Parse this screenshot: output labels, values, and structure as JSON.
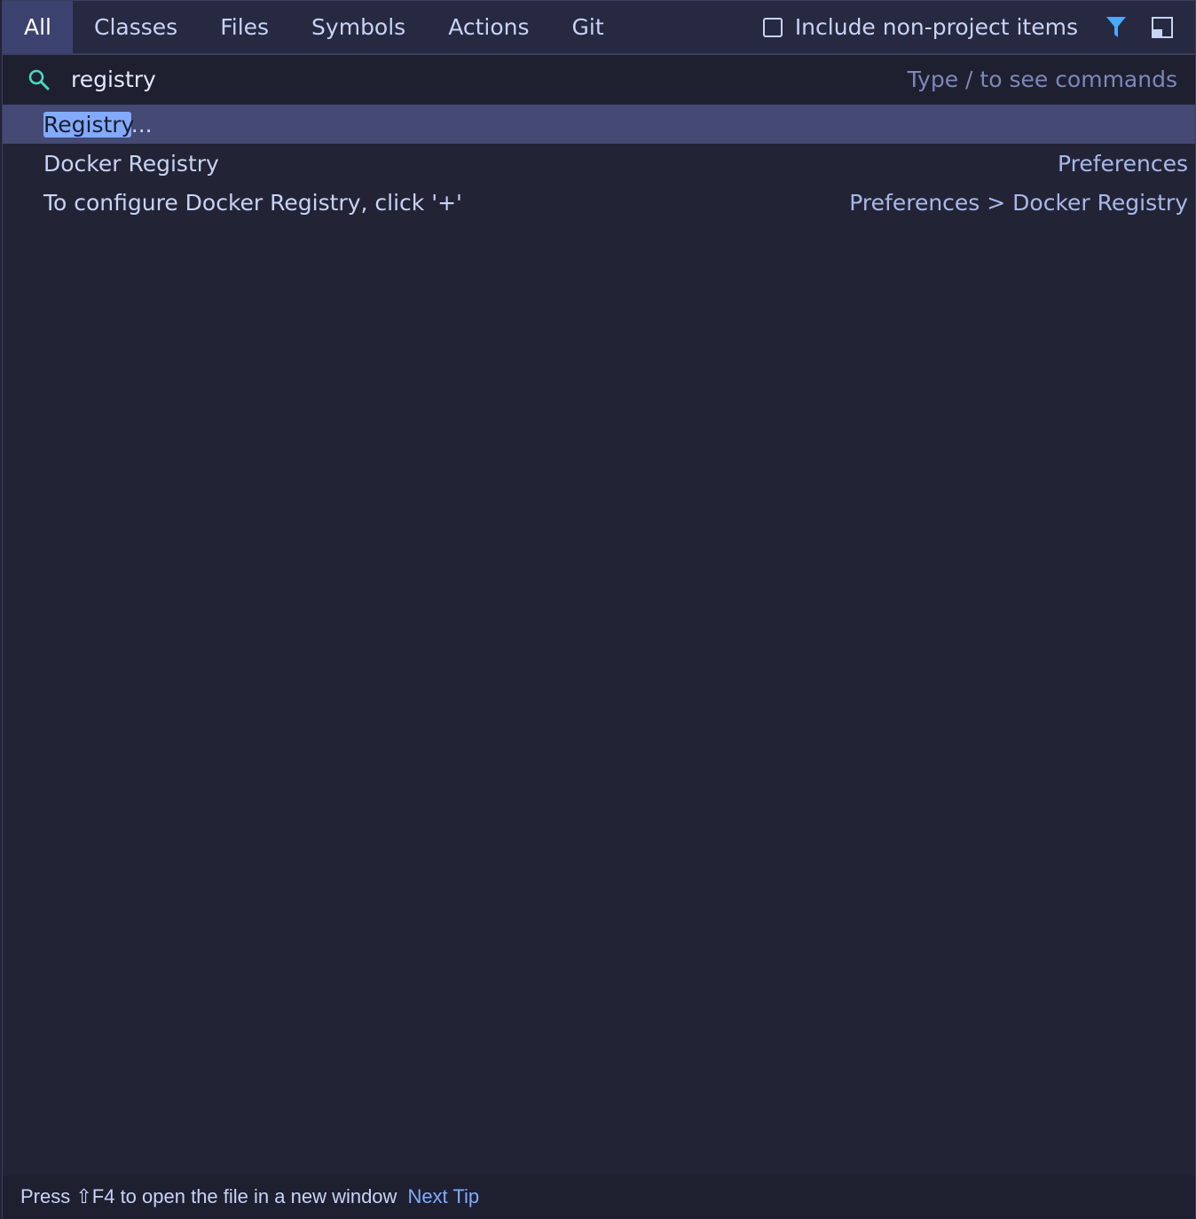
{
  "tabs": [
    "All",
    "Classes",
    "Files",
    "Symbols",
    "Actions",
    "Git"
  ],
  "active_tab": "All",
  "options": {
    "include_label": "Include non-project items",
    "include_checked": false
  },
  "icons": {
    "filter": "filter-icon",
    "layout": "split-panel-icon",
    "search": "search-icon"
  },
  "search": {
    "value": "registry",
    "hint": "Type / to see commands"
  },
  "results": [
    {
      "match": "Registry",
      "rest": "...",
      "location": ""
    },
    {
      "match": "",
      "rest": "Docker Registry",
      "location": "Preferences"
    },
    {
      "match": "",
      "rest": "To configure Docker Registry, click '+'",
      "location": "Preferences > Docker Registry"
    }
  ],
  "footer": {
    "tip": "Press ⇧F4 to open the file in a new window",
    "next_tip": "Next Tip"
  },
  "colors": {
    "accent": "#82aaff",
    "background": "#222436",
    "selected_row": "#444a73"
  }
}
